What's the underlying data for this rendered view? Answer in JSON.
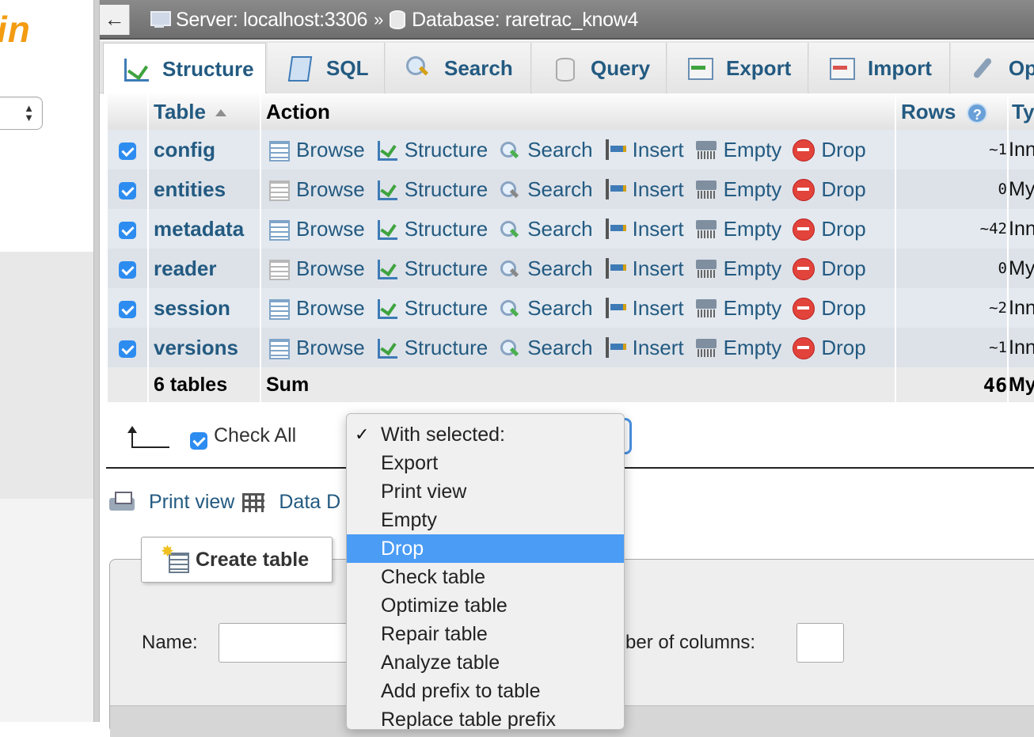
{
  "breadcrumb": {
    "back_glyph": "←",
    "server": "Server: localhost:3306",
    "separator": "»",
    "database": "Database: raretrac_know4"
  },
  "sidebar": {
    "logo_fragment": "in",
    "select_arrows": "▲▼"
  },
  "tabs": [
    {
      "label": "Structure",
      "icon": "structure-icon",
      "active": true
    },
    {
      "label": "SQL",
      "icon": "sql-icon"
    },
    {
      "label": "Search",
      "icon": "search-icon"
    },
    {
      "label": "Query",
      "icon": "query-icon"
    },
    {
      "label": "Export",
      "icon": "export-icon"
    },
    {
      "label": "Import",
      "icon": "import-icon"
    },
    {
      "label": "Op",
      "icon": "wrench-icon"
    }
  ],
  "table": {
    "columns": {
      "table": "Table",
      "action": "Action",
      "rows": "Rows",
      "type": "Ty"
    },
    "help_glyph": "?",
    "actions": {
      "browse": "Browse",
      "structure": "Structure",
      "search": "Search",
      "insert": "Insert",
      "empty": "Empty",
      "drop": "Drop"
    },
    "rows": [
      {
        "name": "config",
        "rows": "~1",
        "type": "Inn",
        "empty_table": false
      },
      {
        "name": "entities",
        "rows": "0",
        "type": "My",
        "empty_table": true
      },
      {
        "name": "metadata",
        "rows": "~42",
        "type": "Inn",
        "empty_table": false
      },
      {
        "name": "reader",
        "rows": "0",
        "type": "My",
        "empty_table": true
      },
      {
        "name": "session",
        "rows": "~2",
        "type": "Inn",
        "empty_table": false
      },
      {
        "name": "versions",
        "rows": "~1",
        "type": "Inn",
        "empty_table": false
      }
    ],
    "summary": {
      "count": "6 tables",
      "label": "Sum",
      "rows": "46",
      "type": "My"
    }
  },
  "bulk": {
    "check_all_label": "Check All",
    "with_selected": {
      "checkmark": "✓",
      "selected_value": "Drop",
      "options": [
        "With selected:",
        "Export",
        "Print view",
        "Empty",
        "Drop",
        "Check table",
        "Optimize table",
        "Repair table",
        "Analyze table",
        "Add prefix to table",
        "Replace table prefix"
      ]
    }
  },
  "links": {
    "print_view": "Print view",
    "data_dictionary": "Data D"
  },
  "create_table": {
    "legend": "Create table",
    "name_label": "Name:",
    "columns_label": "mber of columns:"
  },
  "colors": {
    "link": "#235a81",
    "row_odd": "#e3e9ef",
    "row_even": "#dde2e9",
    "menu_highlight": "#4a9cf5",
    "checkbox": "#2d8cf0",
    "logo": "#f39c12"
  }
}
